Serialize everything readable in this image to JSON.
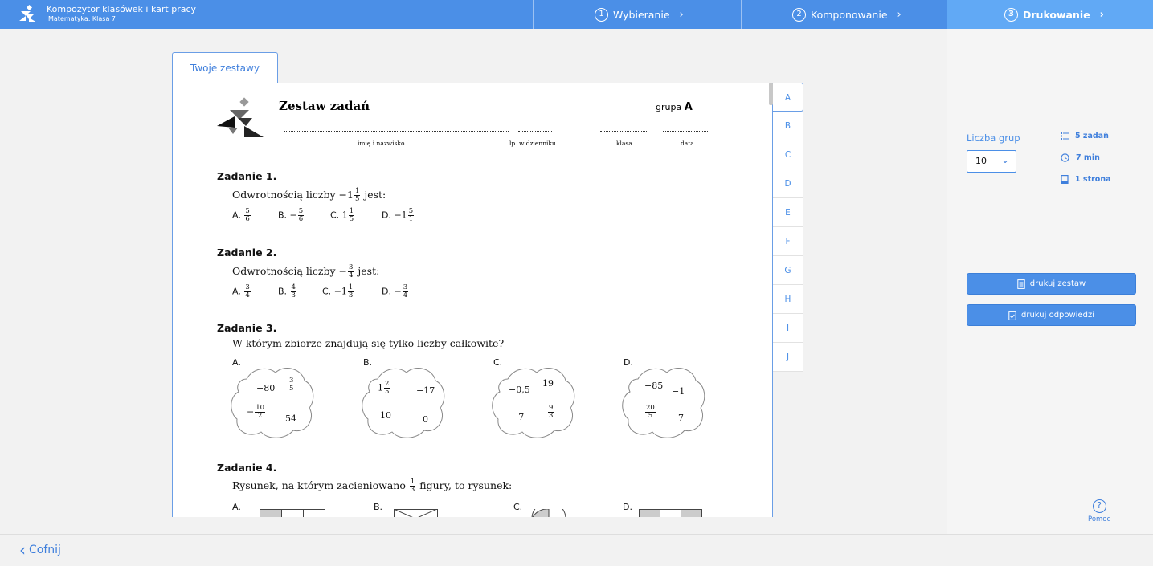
{
  "app": {
    "title": "Kompozytor klasówek i kart pracy",
    "subtitle": "Matematyka. Klasa 7"
  },
  "steps": [
    {
      "num": "1",
      "label": "Wybieranie"
    },
    {
      "num": "2",
      "label": "Komponowanie"
    },
    {
      "num": "3",
      "label": "Drukowanie"
    }
  ],
  "tab": {
    "label": "Twoje zestawy"
  },
  "groups": [
    "A",
    "B",
    "C",
    "D",
    "E",
    "F",
    "G",
    "H",
    "I",
    "J"
  ],
  "sheet": {
    "title": "Zestaw zadań",
    "group_label": "grupa",
    "group_value": "A",
    "fields": [
      "imię i nazwisko",
      "lp. w dzienniku",
      "klasa",
      "data"
    ],
    "tasks": [
      {
        "title": "Zadanie 1.",
        "question_pre": "Odwrotnością liczby −1",
        "q_frac": {
          "n": "1",
          "d": "5"
        },
        "question_post": "jest:",
        "answers": [
          {
            "letter": "A.",
            "text": "",
            "frac": {
              "n": "5",
              "d": "6"
            }
          },
          {
            "letter": "B.",
            "text": "−",
            "frac": {
              "n": "5",
              "d": "6"
            }
          },
          {
            "letter": "C.",
            "text": "1",
            "frac": {
              "n": "1",
              "d": "5"
            }
          },
          {
            "letter": "D.",
            "text": "−1",
            "frac": {
              "n": "5",
              "d": "1"
            }
          }
        ]
      },
      {
        "title": "Zadanie 2.",
        "question_pre": "Odwrotnością liczby −",
        "q_frac": {
          "n": "3",
          "d": "4"
        },
        "question_post": "jest:",
        "answers": [
          {
            "letter": "A.",
            "text": "",
            "frac": {
              "n": "3",
              "d": "4"
            }
          },
          {
            "letter": "B.",
            "text": "",
            "frac": {
              "n": "4",
              "d": "3"
            }
          },
          {
            "letter": "C.",
            "text": "−1",
            "frac": {
              "n": "1",
              "d": "3"
            }
          },
          {
            "letter": "D.",
            "text": "−",
            "frac": {
              "n": "3",
              "d": "4"
            }
          }
        ]
      },
      {
        "title": "Zadanie 3.",
        "question": "W którym zbiorze znajdują się tylko liczby całkowite?",
        "options": [
          "A.",
          "B.",
          "C.",
          "D."
        ],
        "clouds": [
          {
            "a": "−80",
            "b_frac": {
              "n": "3",
              "d": "5"
            },
            "c_pre": "−",
            "c_frac": {
              "n": "10",
              "d": "2"
            },
            "d": "54"
          },
          {
            "a_pre": "1",
            "a_frac": {
              "n": "2",
              "d": "5"
            },
            "b": "−17",
            "c": "10",
            "d": "0"
          },
          {
            "a": "−0,5",
            "b": "19",
            "c": "−7",
            "d_frac": {
              "n": "9",
              "d": "3"
            }
          },
          {
            "a": "−85",
            "b": "−1",
            "c_frac": {
              "n": "20",
              "d": "5"
            },
            "d": "7"
          }
        ]
      },
      {
        "title": "Zadanie 4.",
        "question_pre": "Rysunek, na którym zacieniowano",
        "q_frac": {
          "n": "1",
          "d": "3"
        },
        "question_post": "figury, to rysunek:",
        "options": [
          "A.",
          "B.",
          "C.",
          "D."
        ]
      }
    ]
  },
  "side": {
    "groups_label": "Liczba grup",
    "groups_value": "10",
    "info": [
      {
        "icon": "list-icon",
        "text": "5 zadań"
      },
      {
        "icon": "clock-icon",
        "text": "7 min"
      },
      {
        "icon": "page-icon",
        "text": "1 strona"
      }
    ],
    "print_set": "drukuj zestaw",
    "print_answers": "drukuj odpowiedzi",
    "help": "Pomoc"
  },
  "back": "Cofnij"
}
